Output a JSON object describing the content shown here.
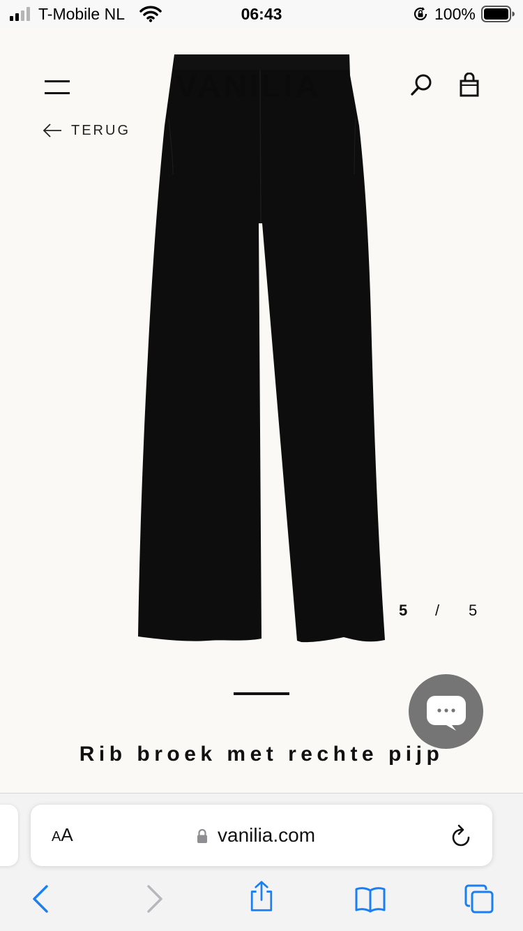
{
  "status_bar": {
    "carrier": "T-Mobile NL",
    "time": "06:43",
    "battery_percent": "100%"
  },
  "header": {
    "logo": "VANILIA",
    "menu_icon": "hamburger-menu-icon",
    "search_icon": "search-icon",
    "bag_icon": "shopping-bag-icon"
  },
  "navigation": {
    "back_label": "TERUG"
  },
  "product": {
    "title": "Rib broek met rechte pijp",
    "image_current": "5",
    "image_separator": "/",
    "image_total": "5",
    "image_color": "#0d0d0d"
  },
  "chat": {
    "icon": "chat-bubble-icon",
    "color": "#757575"
  },
  "browser": {
    "text_size_small": "A",
    "text_size_large": "A",
    "url": "vanilia.com",
    "accent_color": "#1a7ff2",
    "disabled_color": "#b7b7bb"
  }
}
